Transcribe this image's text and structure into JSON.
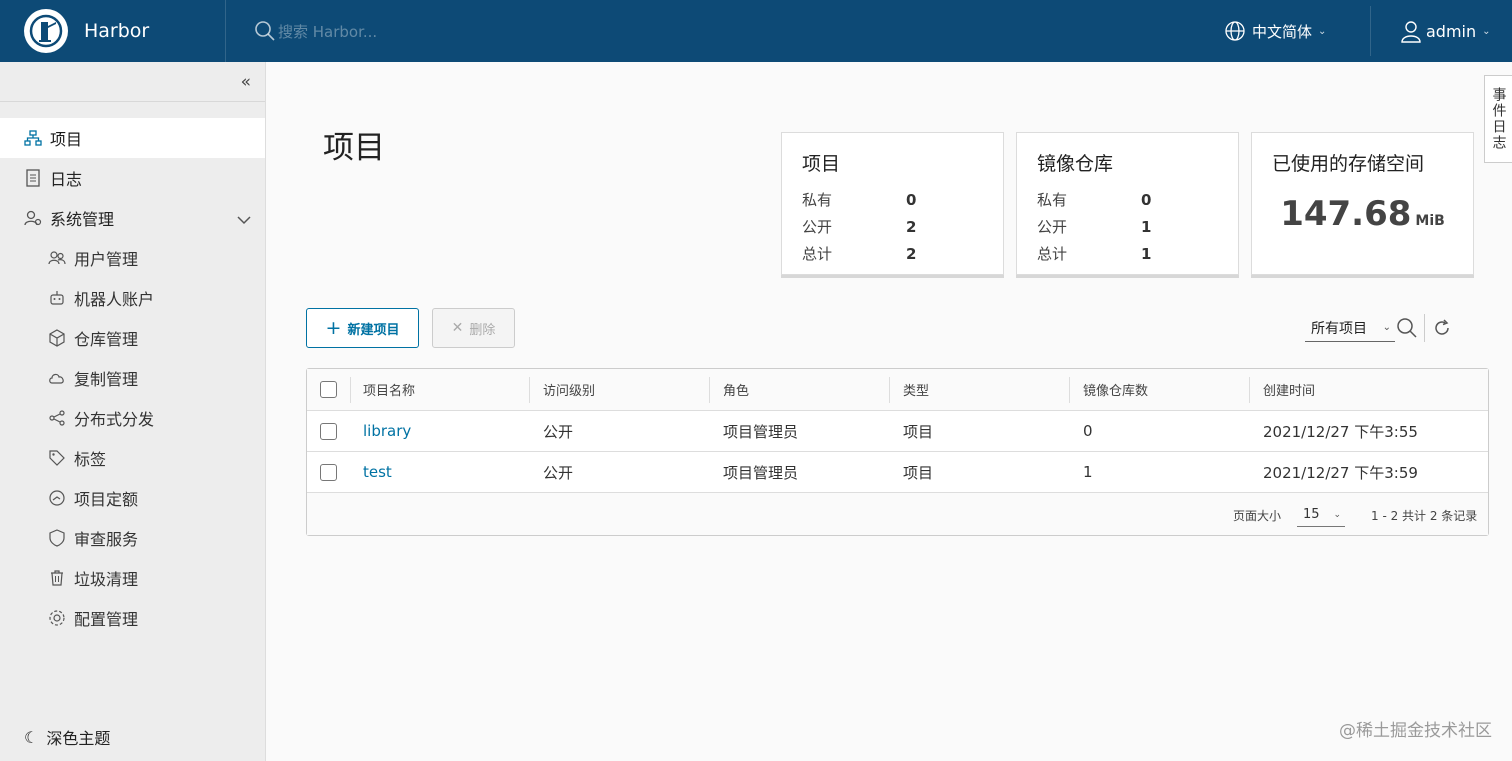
{
  "header": {
    "brand": "Harbor",
    "search_placeholder": "搜索 Harbor...",
    "language": "中文简体",
    "user": "admin",
    "bg_color": "#0d4a76"
  },
  "sidebar": {
    "items": [
      {
        "label": "项目",
        "icon": "projects-icon"
      },
      {
        "label": "日志",
        "icon": "logs-icon"
      },
      {
        "label": "系统管理",
        "icon": "admin-icon"
      },
      {
        "label": "用户管理",
        "icon": "users-icon"
      },
      {
        "label": "机器人账户",
        "icon": "robot-icon"
      },
      {
        "label": "仓库管理",
        "icon": "registry-icon"
      },
      {
        "label": "复制管理",
        "icon": "replication-icon"
      },
      {
        "label": "分布式分发",
        "icon": "share-icon"
      },
      {
        "label": "标签",
        "icon": "tag-icon"
      },
      {
        "label": "项目定额",
        "icon": "quota-icon"
      },
      {
        "label": "审查服务",
        "icon": "shield-icon"
      },
      {
        "label": "垃圾清理",
        "icon": "trash-icon"
      },
      {
        "label": "配置管理",
        "icon": "gear-icon"
      }
    ],
    "dark_theme": "深色主题"
  },
  "main": {
    "title": "项目",
    "cards": {
      "projects": {
        "title": "项目",
        "rows": [
          {
            "label": "私有",
            "value": "0"
          },
          {
            "label": "公开",
            "value": "2"
          },
          {
            "label": "总计",
            "value": "2"
          }
        ]
      },
      "repos": {
        "title": "镜像仓库",
        "rows": [
          {
            "label": "私有",
            "value": "0"
          },
          {
            "label": "公开",
            "value": "1"
          },
          {
            "label": "总计",
            "value": "1"
          }
        ]
      },
      "storage": {
        "title": "已使用的存储空间",
        "value": "147.68",
        "unit": "MiB"
      }
    },
    "new_project": "新建项目",
    "delete": "删除",
    "filter": "所有项目",
    "table": {
      "headers": [
        "项目名称",
        "访问级别",
        "角色",
        "类型",
        "镜像仓库数",
        "创建时间"
      ],
      "rows": [
        [
          "library",
          "公开",
          "项目管理员",
          "项目",
          "0",
          "2021/12/27 下午3:55"
        ],
        [
          "test",
          "公开",
          "项目管理员",
          "项目",
          "1",
          "2021/12/27 下午3:59"
        ]
      ],
      "page_size_label": "页面大小",
      "page_size": "15",
      "summary": "1 - 2 共计 2 条记录"
    }
  },
  "event_log": "事件日志",
  "watermark": "@稀土掘金技术社区",
  "accent_color": "#0072a3"
}
